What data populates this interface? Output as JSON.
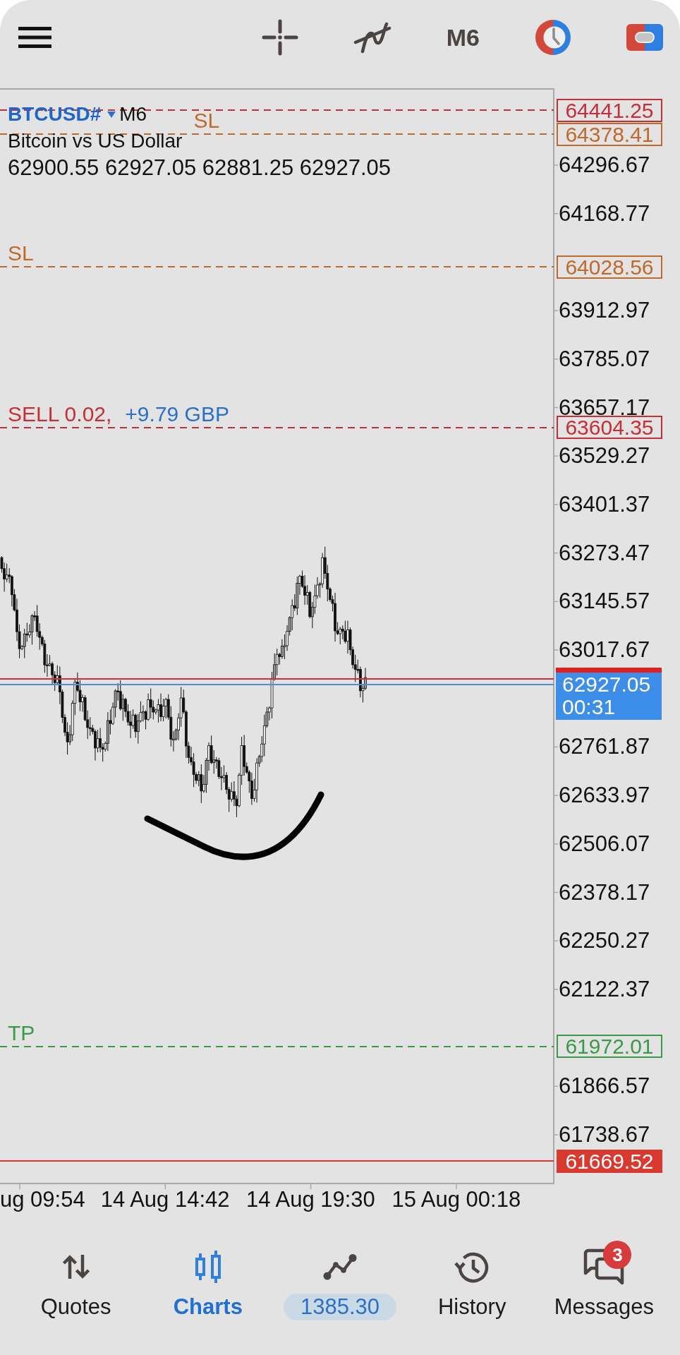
{
  "toolbar": {
    "buttons": [
      {
        "kind": "menu"
      },
      {
        "kind": "crosshair"
      },
      {
        "kind": "indicators"
      },
      {
        "kind": "timeframe",
        "label": "M6"
      },
      {
        "kind": "clock"
      },
      {
        "kind": "trading"
      }
    ]
  },
  "chart": {
    "symbol": "BTCUSD#",
    "timeframe": "M6",
    "description": "Bitcoin vs US Dollar",
    "ohlc": "62900.55 62927.05 62881.25 62927.05",
    "price_ticks": [
      "64296.67",
      "64168.77",
      "63912.97",
      "63785.07",
      "63657.17",
      "63529.27",
      "63401.37",
      "63273.47",
      "63145.57",
      "63017.67",
      "62761.87",
      "62633.97",
      "62506.07",
      "62378.17",
      "62250.27",
      "62122.37",
      "61866.57",
      "61738.67"
    ],
    "order_lines": [
      {
        "kind": "order",
        "price": "64441.25",
        "color": "#c62f35"
      },
      {
        "kind": "stop_loss",
        "label": "SL",
        "price": "64378.41",
        "color": "#c0692c"
      },
      {
        "kind": "stop_loss",
        "label": "SL",
        "price": "64028.56",
        "color": "#c0692c"
      },
      {
        "kind": "order",
        "label": "SELL 0.02,",
        "profit": "+9.79 GBP",
        "price": "63604.35",
        "color": "#c62f35"
      },
      {
        "kind": "take_profit",
        "label": "TP",
        "price": "61972.01",
        "color": "#3b9a47"
      },
      {
        "kind": "level",
        "price": "61669.52",
        "color": "#d83a2f"
      }
    ],
    "bid": {
      "price": "62927.05",
      "timer": "00:31"
    },
    "time_labels": [
      "ug 09:54",
      "14 Aug 14:42",
      "14 Aug 19:30",
      "15 Aug 00:18"
    ]
  },
  "nav": {
    "items": [
      {
        "kind": "quotes",
        "label": "Quotes",
        "selected": false
      },
      {
        "kind": "charts",
        "label": "Charts",
        "selected": true
      },
      {
        "kind": "trade",
        "label": "1385.30",
        "selected": false
      },
      {
        "kind": "history",
        "label": "History",
        "selected": false
      },
      {
        "kind": "messages",
        "label": "Messages",
        "badge": "3",
        "selected": false
      }
    ]
  }
}
